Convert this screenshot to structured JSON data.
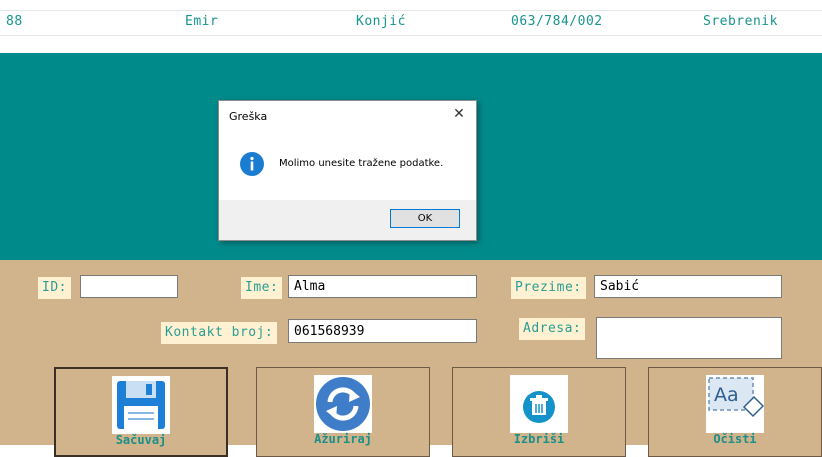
{
  "record": {
    "id": "88",
    "ime": "Emir",
    "prezime": "Konjić",
    "telefon": "063/784/002",
    "grad": "Srebrenik"
  },
  "form": {
    "id_label": "ID:",
    "id_value": "",
    "ime_label": "Ime:",
    "ime_value": "Alma",
    "prezime_label": "Prezime:",
    "prezime_value": "Šabić",
    "kontakt_label": "Kontakt broj:",
    "kontakt_value": "061568939",
    "adresa_label": "Adresa:",
    "adresa_value": ""
  },
  "buttons": {
    "save": "Sačuvaj",
    "update": "Ažuriraj",
    "delete": "Izbriši",
    "clear": "Očisti"
  },
  "dialog": {
    "title": "Greška",
    "close": "✕",
    "message": "Molimo unesite tražene podatke.",
    "ok": "OK"
  },
  "colors": {
    "teal": "#008b8b",
    "tan": "#d1b48c",
    "label_bg": "#fff1d2",
    "text_teal": "#17958d",
    "accent": "#0078d7"
  }
}
